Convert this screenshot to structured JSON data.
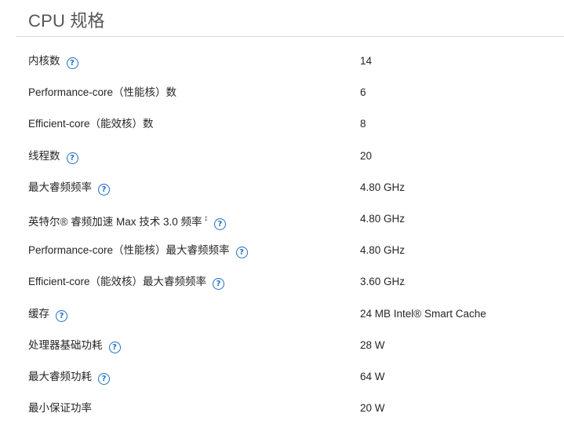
{
  "section": {
    "title": "CPU 规格"
  },
  "specs": [
    {
      "label": "内核数",
      "value": "14",
      "help": true
    },
    {
      "label": "Performance-core（性能核）数",
      "value": "6",
      "help": false
    },
    {
      "label": "Efficient-core（能效核）数",
      "value": "8",
      "help": false
    },
    {
      "label": "线程数",
      "value": "20",
      "help": true
    },
    {
      "label": "最大睿频频率",
      "value": "4.80 GHz",
      "help": true
    },
    {
      "label": "英特尔® 睿频加速 Max 技术 3.0 频率",
      "footnote": "‡",
      "value": "4.80 GHz",
      "help": true
    },
    {
      "label": "Performance-core（性能核）最大睿频频率",
      "value": "4.80 GHz",
      "help": true
    },
    {
      "label": "Efficient-core（能效核）最大睿频频率",
      "value": "3.60 GHz",
      "help": true
    },
    {
      "label": "缓存",
      "value": "24 MB Intel® Smart Cache",
      "help": true
    },
    {
      "label": "处理器基础功耗",
      "value": "28 W",
      "help": true
    },
    {
      "label": "最大睿频功耗",
      "value": "64 W",
      "help": true
    },
    {
      "label": "最小保证功率",
      "value": "20 W",
      "help": false
    }
  ],
  "icons": {
    "help_glyph": "?",
    "help_color": "#1f6fc5"
  }
}
